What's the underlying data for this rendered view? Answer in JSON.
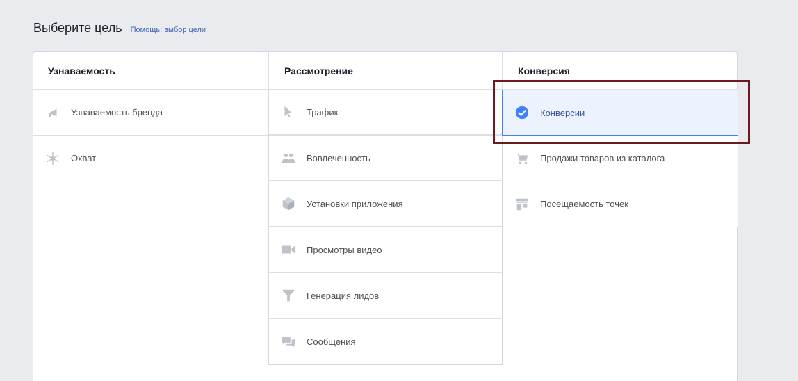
{
  "header": {
    "title": "Выберите цель",
    "help_link": "Помощь: выбор цели"
  },
  "columns": [
    {
      "title": "Узнаваемость",
      "items": [
        {
          "label": "Узнаваемость бренда",
          "icon": "megaphone-icon"
        },
        {
          "label": "Охват",
          "icon": "reach-icon"
        }
      ]
    },
    {
      "title": "Рассмотрение",
      "items": [
        {
          "label": "Трафик",
          "icon": "cursor-icon"
        },
        {
          "label": "Вовлеченность",
          "icon": "people-icon"
        },
        {
          "label": "Установки приложения",
          "icon": "box-icon"
        },
        {
          "label": "Просмотры видео",
          "icon": "video-camera-icon"
        },
        {
          "label": "Генерация лидов",
          "icon": "funnel-icon"
        },
        {
          "label": "Сообщения",
          "icon": "chat-bubbles-icon"
        }
      ]
    },
    {
      "title": "Конверсия",
      "items": [
        {
          "label": "Конверсии",
          "icon": "checkmark-circle-icon",
          "selected": true
        },
        {
          "label": "Продажи товаров из каталога",
          "icon": "shopping-cart-icon"
        },
        {
          "label": "Посещаемость точек",
          "icon": "storefront-icon"
        }
      ]
    }
  ],
  "colors": {
    "icon_gray": "#bec3c9",
    "selected_blue": "#4080ff",
    "selected_bg": "#ecf3ff",
    "highlight_frame": "#6b1a1f",
    "link": "#4267b2"
  }
}
